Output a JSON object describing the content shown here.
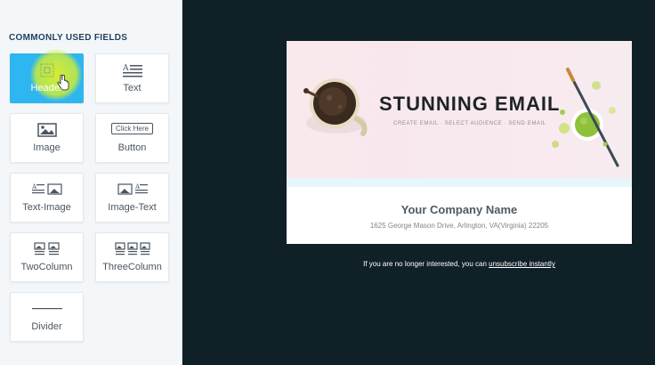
{
  "sidebar": {
    "title": "COMMONLY USED FIELDS",
    "tiles": [
      {
        "label": "Header",
        "icon": "header-icon",
        "active": true
      },
      {
        "label": "Text",
        "icon": "text-lines-icon"
      },
      {
        "label": "Image",
        "icon": "image-icon"
      },
      {
        "label": "Button",
        "icon": "button-icon",
        "icon_text": "Click Here"
      },
      {
        "label": "Text-Image",
        "icon": "text-image-icon"
      },
      {
        "label": "Image-Text",
        "icon": "image-text-icon"
      },
      {
        "label": "TwoColumn",
        "icon": "two-column-icon"
      },
      {
        "label": "ThreeColumn",
        "icon": "three-column-icon"
      },
      {
        "label": "Divider",
        "icon": "divider-icon"
      }
    ]
  },
  "email": {
    "headline": "STUNNING EMAIL",
    "subnav": "CREATE EMAIL  ·  SELECT AUDIENCE  ·  SEND EMAIL",
    "company": "Your Company Name",
    "address": "1625 George Mason Drive, Arlington, VA(Virginia) 22205"
  },
  "footer": {
    "text": "If you are no longer interested, you can ",
    "link": "unsubscribe instantly"
  },
  "colors": {
    "accent": "#2eb6f0",
    "background": "#0f2026",
    "banner": "#f9e8ec",
    "highlight": "#dcf028"
  }
}
